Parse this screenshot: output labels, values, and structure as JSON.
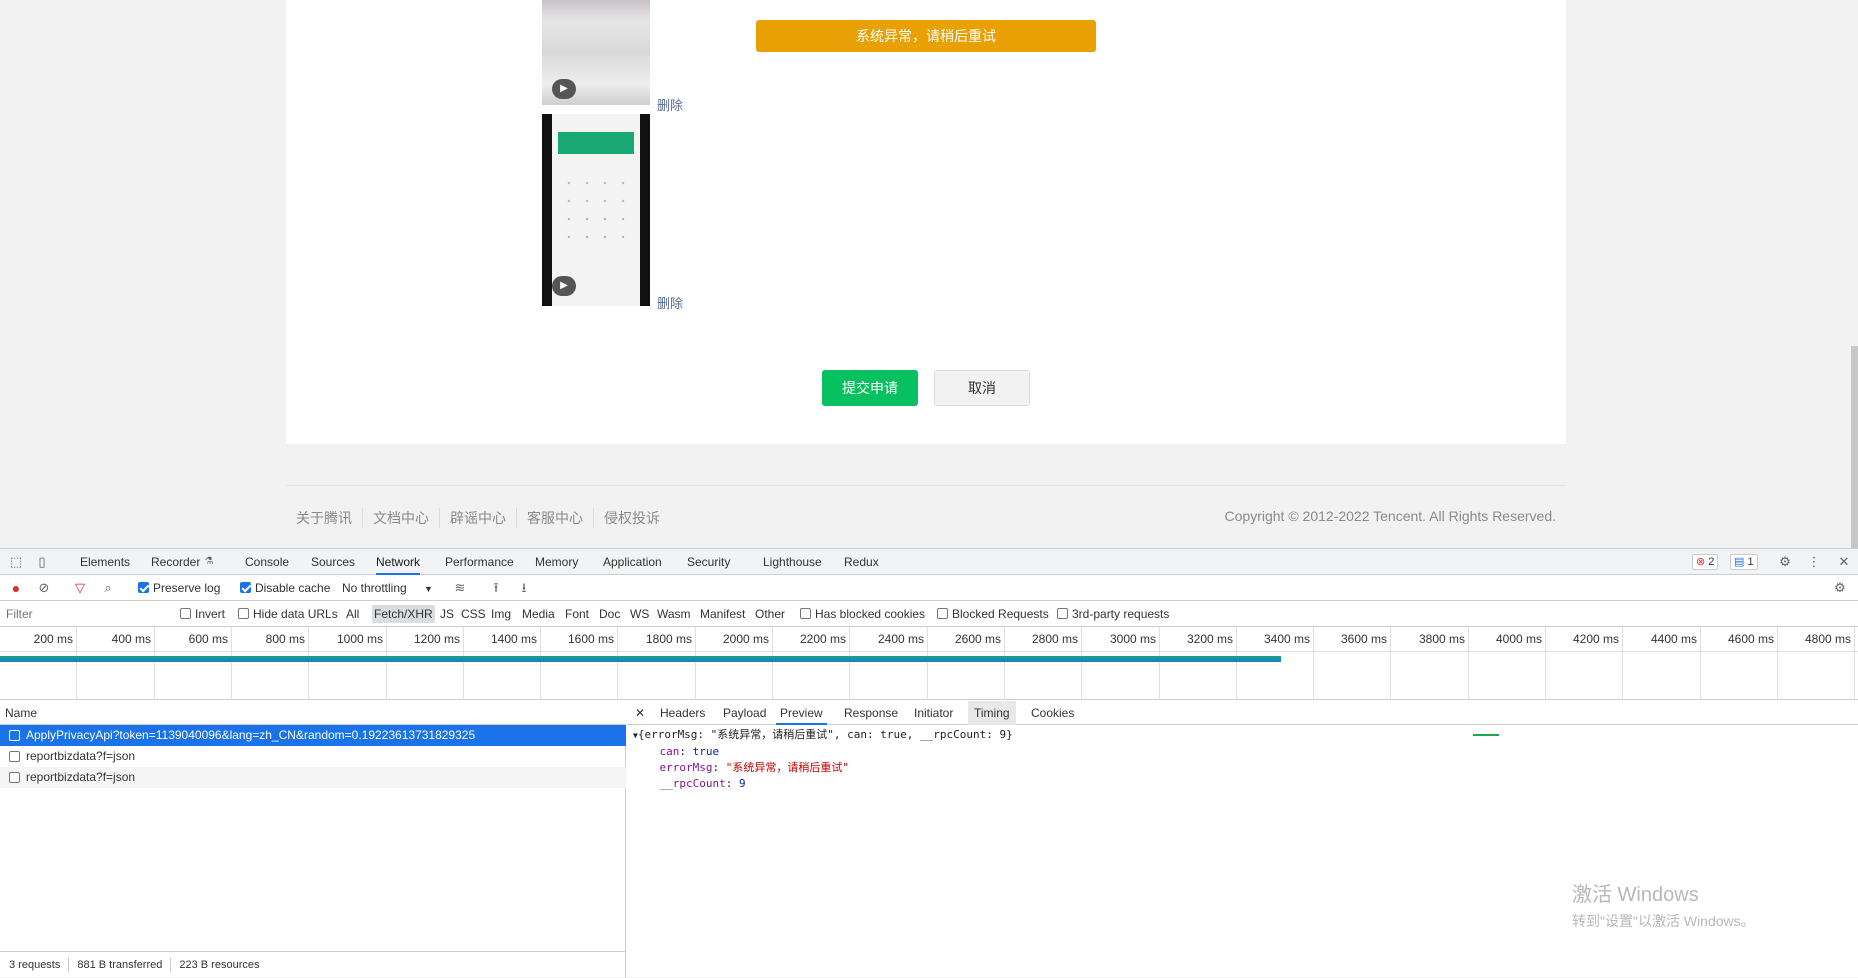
{
  "page": {
    "toast": "系统异常，请稍后重试",
    "delete_label": "删除",
    "play_icon": "play-icon",
    "submit_label": "提交申请",
    "cancel_label": "取消",
    "footer_links": [
      "关于腾讯",
      "文档中心",
      "辟谣中心",
      "客服中心",
      "侵权投诉"
    ],
    "copyright": "Copyright © 2012-2022 Tencent. All Rights Reserved.",
    "colors": {
      "toast": "#e9a005",
      "submit": "#07c160",
      "link": "#576b95"
    }
  },
  "devtools": {
    "tabs": [
      "Elements",
      "Recorder",
      "Console",
      "Sources",
      "Network",
      "Performance",
      "Memory",
      "Application",
      "Security",
      "Lighthouse",
      "Redux"
    ],
    "active_tab": "Network",
    "error_count": "2",
    "message_count": "1",
    "toolbar": {
      "preserve_log": "Preserve log",
      "disable_cache": "Disable cache",
      "throttling": "No throttling"
    },
    "filter": {
      "placeholder": "Filter",
      "invert": "Invert",
      "hide_data_urls": "Hide data URLs",
      "types": [
        "All",
        "Fetch/XHR",
        "JS",
        "CSS",
        "Img",
        "Media",
        "Font",
        "Doc",
        "WS",
        "Wasm",
        "Manifest",
        "Other"
      ],
      "active_type": "Fetch/XHR",
      "has_blocked_cookies": "Has blocked cookies",
      "blocked_requests": "Blocked Requests",
      "third_party": "3rd-party requests"
    },
    "timeline_ticks": [
      "200 ms",
      "400 ms",
      "600 ms",
      "800 ms",
      "1000 ms",
      "1200 ms",
      "1400 ms",
      "1600 ms",
      "1800 ms",
      "2000 ms",
      "2200 ms",
      "2400 ms",
      "2600 ms",
      "2800 ms",
      "3000 ms",
      "3200 ms",
      "3400 ms",
      "3600 ms",
      "3800 ms",
      "4000 ms",
      "4200 ms",
      "4400 ms",
      "4600 ms",
      "4800 ms"
    ],
    "requests_header": "Name",
    "requests": [
      "ApplyPrivacyApi?token=1139040096&lang=zh_CN&random=0.19223613731829325",
      "reportbizdata?f=json",
      "reportbizdata?f=json"
    ],
    "status": {
      "requests": "3 requests",
      "transferred": "881 B transferred",
      "resources": "223 B resources"
    },
    "detail_tabs": [
      "Headers",
      "Payload",
      "Preview",
      "Response",
      "Initiator",
      "Timing",
      "Cookies"
    ],
    "detail_active": "Preview",
    "preview": {
      "summary": "{errorMsg: \"系统异常，请稍后重试\", can: true, __rpcCount: 9}",
      "can_key": "can",
      "can_val": "true",
      "errorMsg_key": "errorMsg",
      "errorMsg_val": "\"系统异常，请稍后重试\"",
      "rpc_key": "__rpcCount",
      "rpc_val": "9"
    }
  },
  "watermark": {
    "line1": "激活 Windows",
    "line2": "转到\"设置\"以激活 Windows。"
  }
}
